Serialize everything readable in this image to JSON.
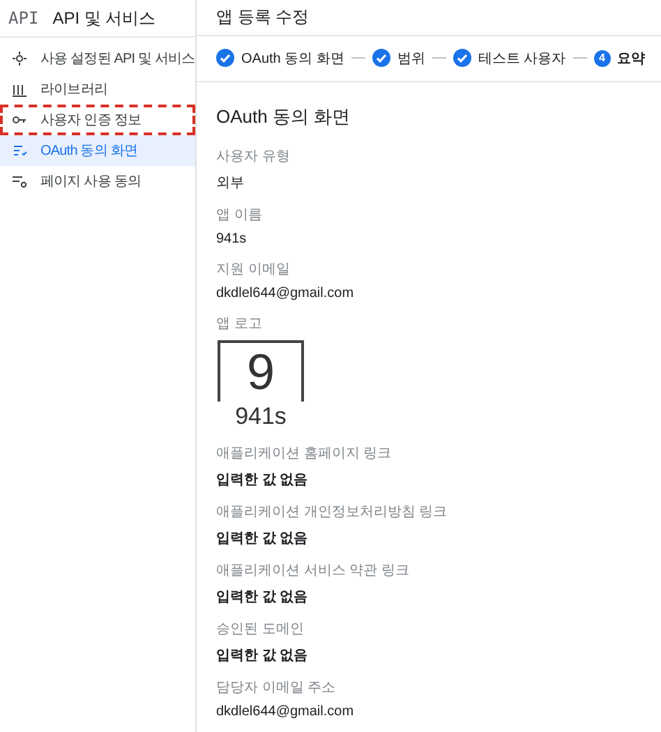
{
  "sidebar": {
    "logo": "API",
    "title": "API 및 서비스",
    "items": [
      {
        "label": "사용 설정된 API 및 서비스",
        "selected": false,
        "highlighted": false
      },
      {
        "label": "라이브러리",
        "selected": false,
        "highlighted": false
      },
      {
        "label": "사용자 인증 정보",
        "selected": false,
        "highlighted": true
      },
      {
        "label": "OAuth 동의 화면",
        "selected": true,
        "highlighted": false
      },
      {
        "label": "페이지 사용 동의",
        "selected": false,
        "highlighted": false
      }
    ]
  },
  "main": {
    "title": "앱 등록 수정",
    "steps": [
      {
        "label": "OAuth 동의 화면",
        "done": true
      },
      {
        "label": "범위",
        "done": true
      },
      {
        "label": "테스트 사용자",
        "done": true
      },
      {
        "label": "요약",
        "done": false,
        "number": "4"
      }
    ],
    "section_title": "OAuth 동의 화면",
    "fields": [
      {
        "kind": "text",
        "label": "사용자 유형",
        "value": "외부"
      },
      {
        "kind": "text",
        "label": "앱 이름",
        "value": "941s"
      },
      {
        "kind": "text",
        "label": "지원 이메일",
        "value": "dkdlel644@gmail.com"
      },
      {
        "kind": "logo",
        "label": "앱 로고",
        "mark": "9",
        "caption": "941s"
      },
      {
        "kind": "empty",
        "label": "애플리케이션 홈페이지 링크",
        "value": "입력한 값 없음"
      },
      {
        "kind": "empty",
        "label": "애플리케이션 개인정보처리방침 링크",
        "value": "입력한 값 없음"
      },
      {
        "kind": "empty",
        "label": "애플리케이션 서비스 약관 링크",
        "value": "입력한 값 없음"
      },
      {
        "kind": "empty",
        "label": "승인된 도메인",
        "value": "입력한 값 없음"
      },
      {
        "kind": "text",
        "label": "담당자 이메일 주소",
        "value": "dkdlel644@gmail.com"
      }
    ]
  }
}
